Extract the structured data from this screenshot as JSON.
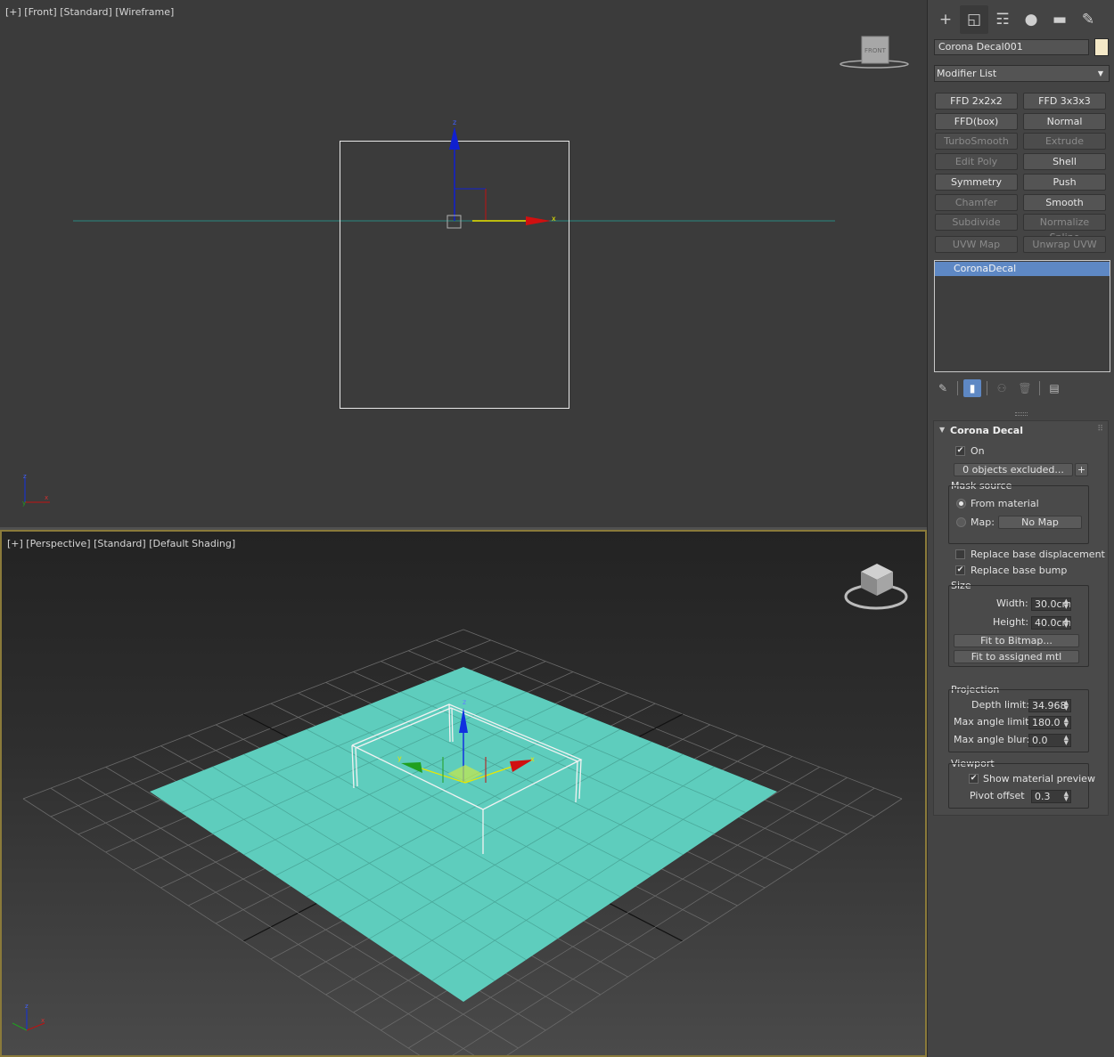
{
  "viewports": {
    "front": {
      "label": "[+] [Front] [Standard] [Wireframe]",
      "viewcube_label": "FRONT",
      "gizmo": {
        "z": "z",
        "x": "x"
      },
      "axis_tripod": {
        "z": "z",
        "x": "x",
        "y": "y"
      }
    },
    "perspective": {
      "label": "[+] [Perspective] [Standard] [Default Shading]",
      "viewcube_label": "",
      "gizmo": {
        "z": "z",
        "x": "x",
        "y": "y"
      },
      "axis_tripod": {
        "z": "z",
        "x": "x"
      }
    }
  },
  "panel": {
    "tabs": [
      {
        "name": "create-tab",
        "glyph": "+"
      },
      {
        "name": "modify-tab",
        "glyph": "◱"
      },
      {
        "name": "hierarchy-tab",
        "glyph": "☶"
      },
      {
        "name": "motion-tab",
        "glyph": "●"
      },
      {
        "name": "display-tab",
        "glyph": "▬"
      },
      {
        "name": "utilities-tab",
        "glyph": "✎"
      }
    ],
    "object_name": "Corona Decal001",
    "object_color": "#f5e9c8",
    "modifier_list": "Modifier List",
    "modifier_buttons": [
      {
        "label": "FFD 2x2x2",
        "enabled": true
      },
      {
        "label": "FFD 3x3x3",
        "enabled": true
      },
      {
        "label": "FFD(box)",
        "enabled": true
      },
      {
        "label": "Normal",
        "enabled": true
      },
      {
        "label": "TurboSmooth",
        "enabled": false
      },
      {
        "label": "Extrude",
        "enabled": false
      },
      {
        "label": "Edit Poly",
        "enabled": false
      },
      {
        "label": "Shell",
        "enabled": true
      },
      {
        "label": "Symmetry",
        "enabled": true
      },
      {
        "label": "Push",
        "enabled": true
      },
      {
        "label": "Chamfer",
        "enabled": false
      },
      {
        "label": "Smooth",
        "enabled": true
      },
      {
        "label": "Subdivide",
        "enabled": false
      },
      {
        "label": "Normalize Spline",
        "enabled": false
      },
      {
        "label": "UVW Map",
        "enabled": false
      },
      {
        "label": "Unwrap UVW",
        "enabled": false
      }
    ],
    "stack_items": [
      "CoronaDecal"
    ],
    "rollout": {
      "title": "Corona Decal",
      "on_label": "On",
      "on_checked": true,
      "excluded_button": "0 objects excluded...",
      "plus_button": "+",
      "mask_source": {
        "title": "Mask source",
        "from_material": "From material",
        "map_label": "Map:",
        "map_button": "No Map",
        "selected": "from_material"
      },
      "replace_displacement": {
        "label": "Replace base displacement",
        "checked": false
      },
      "replace_bump": {
        "label": "Replace base bump",
        "checked": true
      },
      "size": {
        "title": "Size",
        "width_label": "Width:",
        "width_value": "30.0cm",
        "height_label": "Height:",
        "height_value": "40.0cm",
        "fit_bitmap": "Fit to Bitmap...",
        "fit_mtl": "Fit to assigned mtl"
      },
      "projection": {
        "title": "Projection",
        "depth_label": "Depth limit:",
        "depth_value": "34.968",
        "max_angle_label": "Max angle limit:",
        "max_angle_value": "180.0",
        "blur_label": "Max angle blur:",
        "blur_value": "0.0"
      },
      "viewport": {
        "title": "Viewport",
        "show_preview": {
          "label": "Show material preview",
          "checked": true
        },
        "pivot_label": "Pivot offset",
        "pivot_value": "0.3"
      }
    }
  },
  "colors": {
    "accent": "#5e88c4",
    "active_viewport_border": "#8a7a3a",
    "plane": "#5ecdbd",
    "axis_x": "#d01010",
    "axis_y": "#20c020",
    "axis_z": "#1030e0",
    "gizmo_x_label": "#e8e800"
  }
}
